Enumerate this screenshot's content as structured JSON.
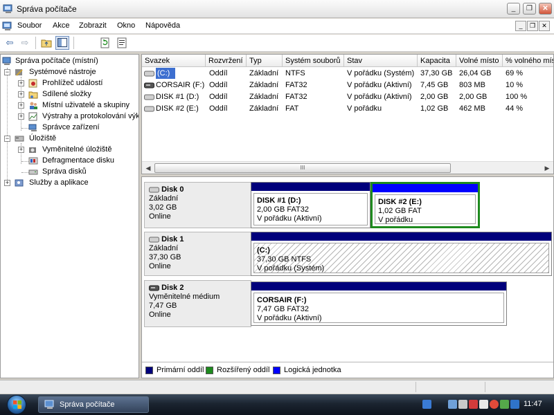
{
  "window": {
    "title": "Správa počítače",
    "buttons": {
      "minimize": "_",
      "restore": "❐",
      "close": "✕"
    }
  },
  "menu": {
    "items": [
      "Soubor",
      "Akce",
      "Zobrazit",
      "Okno",
      "Nápověda"
    ],
    "mdi_buttons": {
      "minimize": "_",
      "restore": "❐",
      "close": "✕"
    }
  },
  "toolbar": {
    "back": "⇦",
    "forward": "⇨",
    "up": "↑",
    "show_tree": "▥",
    "refresh": "⟳",
    "properties": "▦"
  },
  "tree": {
    "items": [
      {
        "label": "Správa počítače (místní)",
        "icon": "computer-icon"
      },
      {
        "label": "Systémové nástroje",
        "icon": "tools-icon",
        "expander": "−"
      },
      {
        "label": "Prohlížeč událostí",
        "icon": "event-viewer-icon",
        "expander": "+"
      },
      {
        "label": "Sdílené složky",
        "icon": "shared-folder-icon",
        "expander": "+"
      },
      {
        "label": "Místní uživatelé a skupiny",
        "icon": "users-icon",
        "expander": "+"
      },
      {
        "label": "Výstrahy a protokolování výkonu",
        "icon": "performance-icon",
        "expander": "+"
      },
      {
        "label": "Správce zařízení",
        "icon": "device-manager-icon"
      },
      {
        "label": "Úložiště",
        "icon": "storage-icon",
        "expander": "−"
      },
      {
        "label": "Vyměnitelné úložiště",
        "icon": "removable-storage-icon",
        "expander": "+"
      },
      {
        "label": "Defragmentace disku",
        "icon": "defrag-icon"
      },
      {
        "label": "Správa disků",
        "icon": "disk-management-icon"
      },
      {
        "label": "Služby a aplikace",
        "icon": "services-icon",
        "expander": "+"
      }
    ]
  },
  "volumes": {
    "columns": [
      "Svazek",
      "Rozvržení",
      "Typ",
      "Systém souborů",
      "Stav",
      "Kapacita",
      "Volné místo",
      "% volného místa"
    ],
    "rows": [
      [
        "(C:)",
        "Oddíl",
        "Základní",
        "NTFS",
        "V pořádku (Systém)",
        "37,30 GB",
        "26,04 GB",
        "69 %"
      ],
      [
        "CORSAIR (F:)",
        "Oddíl",
        "Základní",
        "FAT32",
        "V pořádku (Aktivní)",
        "7,45 GB",
        "803 MB",
        "10 %"
      ],
      [
        "DISK #1 (D:)",
        "Oddíl",
        "Základní",
        "FAT32",
        "V pořádku (Aktivní)",
        "2,00 GB",
        "2,00 GB",
        "100 %"
      ],
      [
        "DISK #2 (E:)",
        "Oddíl",
        "Základní",
        "FAT",
        "V pořádku",
        "1,02 GB",
        "462 MB",
        "44 %"
      ]
    ],
    "scroll_grip": "III"
  },
  "disks": [
    {
      "name": "Disk 0",
      "type": "Základní",
      "size": "3,02 GB",
      "status": "Online",
      "partitions": [
        {
          "name": "DISK #1  (D:)",
          "size": "2,00 GB FAT32",
          "status": "V pořádku (Aktivní)"
        },
        {
          "name": "DISK #2  (E:)",
          "size": "1,02 GB FAT",
          "status": "V pořádku"
        }
      ]
    },
    {
      "name": "Disk 1",
      "type": "Základní",
      "size": "37,30 GB",
      "status": "Online",
      "partitions": [
        {
          "name": "(C:)",
          "size": "37,30 GB NTFS",
          "status": "V pořádku (Systém)"
        }
      ]
    },
    {
      "name": "Disk 2",
      "type": "Vyměnitelné médium",
      "size": "7,47 GB",
      "status": "Online",
      "partitions": [
        {
          "name": "CORSAIR  (F:)",
          "size": "7,47 GB FAT32",
          "status": "V pořádku (Aktivní)"
        }
      ]
    }
  ],
  "legend": [
    {
      "label": "Primární oddíl",
      "color": "#00007b"
    },
    {
      "label": "Rozšířený oddíl",
      "color": "#1e8a1e"
    },
    {
      "label": "Logická jednotka",
      "color": "#0000ff"
    }
  ],
  "taskbar": {
    "task_label": "Správa počítače",
    "clock": "11:47"
  }
}
